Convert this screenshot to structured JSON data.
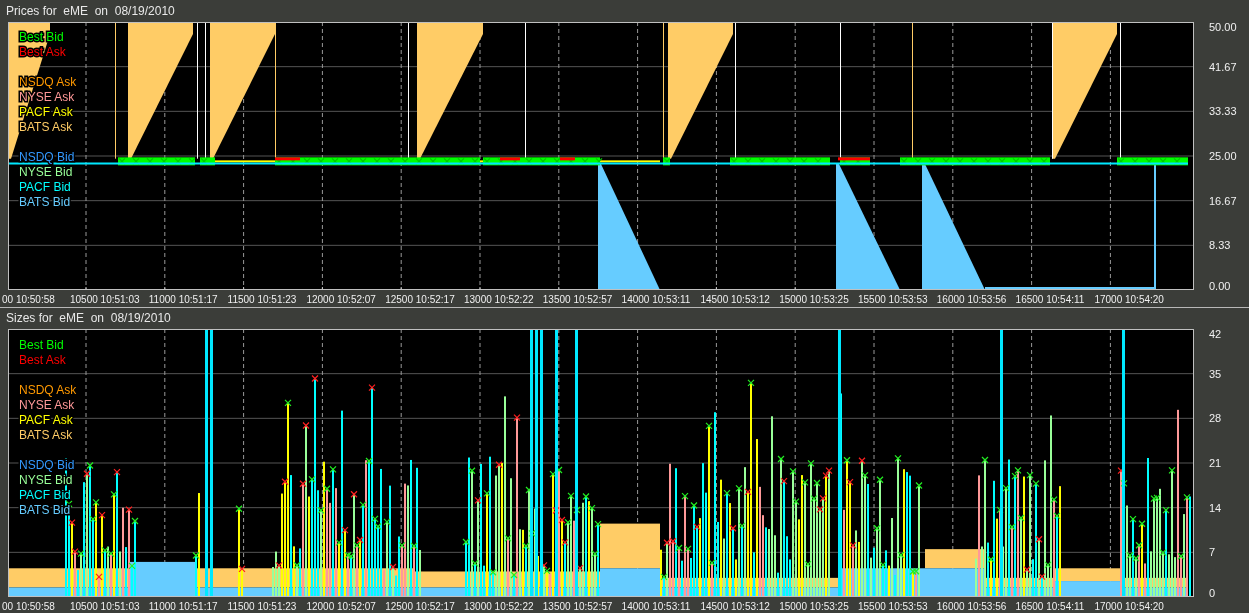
{
  "panels": [
    {
      "kind": "prices",
      "title": "Prices for  eME  on  08/19/2010",
      "legend": [
        {
          "label": "Best Bid",
          "color": "#00ff00"
        },
        {
          "label": "Best Ask",
          "color": "#ff0000"
        },
        {
          "label": "NSDQ Ask",
          "color": "#ff9900"
        },
        {
          "label": "NYSE Ask",
          "color": "#ff9999"
        },
        {
          "label": "PACF Ask",
          "color": "#ffff00"
        },
        {
          "label": "BATS Ask",
          "color": "#ffcc66"
        },
        {
          "label": "NSDQ Bid",
          "color": "#3399ff"
        },
        {
          "label": "NYSE Bid",
          "color": "#99ff99"
        },
        {
          "label": "PACF Bid",
          "color": "#00ffff"
        },
        {
          "label": "BATS Bid",
          "color": "#66ccff"
        }
      ],
      "y_ticks": [
        "50.00",
        "41.67",
        "33.33",
        "25.00",
        "16.67",
        "8.33",
        "0.00"
      ],
      "x_ticks": [
        "00 10:50:58",
        "10500 10:51:03",
        "11000 10:51:17",
        "11500 10:51:23",
        "12000 10:52:07",
        "12500 10:52:17",
        "13000 10:52:22",
        "13500 10:52:57",
        "14000 10:53:11",
        "14500 10:53:12",
        "15000 10:53:25",
        "15500 10:53:53",
        "16000 10:53:56",
        "16500 10:54:11",
        "17000 10:54:20"
      ]
    },
    {
      "kind": "sizes",
      "title": "Sizes for  eME  on  08/19/2010",
      "legend": [
        {
          "label": "Best Bid",
          "color": "#00ff00"
        },
        {
          "label": "Best Ask",
          "color": "#ff0000"
        },
        {
          "label": "NSDQ Ask",
          "color": "#ff9900"
        },
        {
          "label": "NYSE Ask",
          "color": "#ff9999"
        },
        {
          "label": "PACF Ask",
          "color": "#ffff00"
        },
        {
          "label": "BATS Ask",
          "color": "#ffcc66"
        },
        {
          "label": "NSDQ Bid",
          "color": "#3399ff"
        },
        {
          "label": "NYSE Bid",
          "color": "#99ff99"
        },
        {
          "label": "PACF Bid",
          "color": "#00ffff"
        },
        {
          "label": "BATS Bid",
          "color": "#66ccff"
        }
      ],
      "y_ticks": [
        "42",
        "35",
        "28",
        "21",
        "14",
        "7",
        "0"
      ],
      "x_ticks": [
        "00 10:50:58",
        "10500 10:51:03",
        "11000 10:51:17",
        "11500 10:51:23",
        "12000 10:52:07",
        "12500 10:52:17",
        "13000 10:52:22",
        "13500 10:52:57",
        "14000 10:53:11",
        "14500 10:53:12",
        "15000 10:53:25",
        "15500 10:53:53",
        "16000 10:53:56",
        "16500 10:54:11",
        "17000 10:54:20"
      ]
    }
  ]
}
